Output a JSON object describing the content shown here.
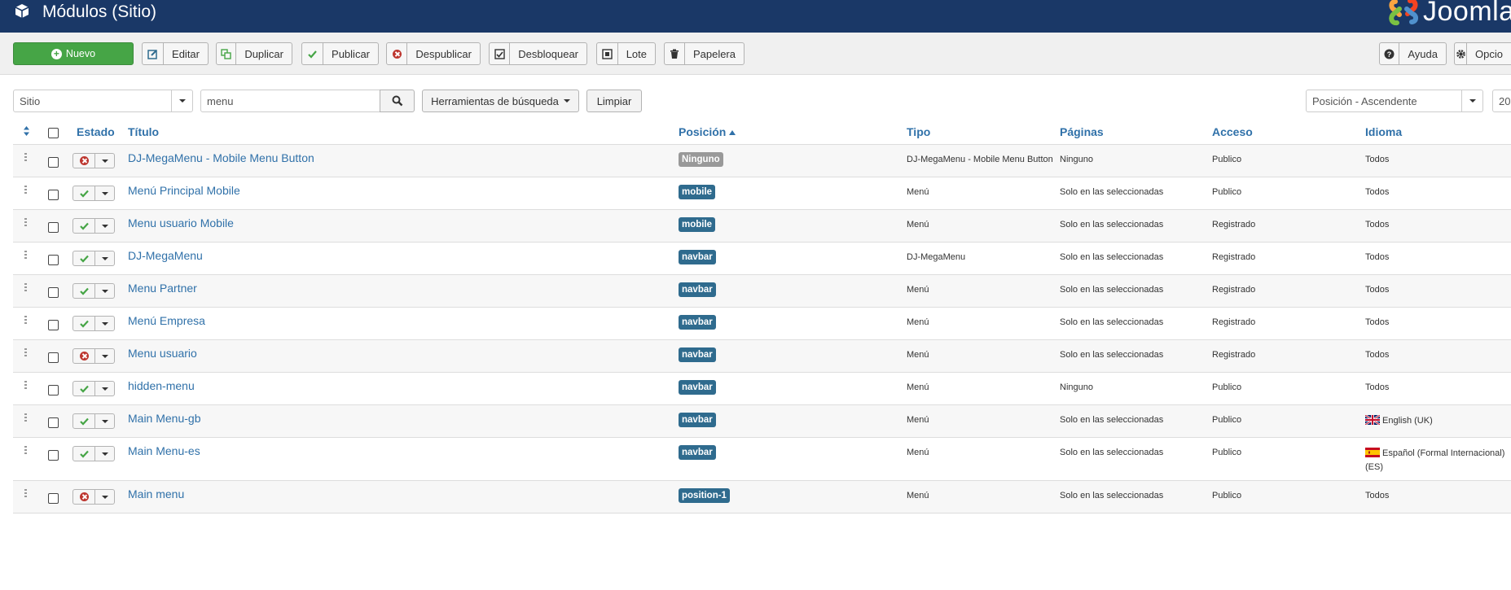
{
  "header": {
    "title": "Módulos (Sitio)",
    "logo_text": "Joomla"
  },
  "toolbar": {
    "new_label": "Nuevo",
    "edit_label": "Editar",
    "duplicate_label": "Duplicar",
    "publish_label": "Publicar",
    "unpublish_label": "Despublicar",
    "checkin_label": "Desbloquear",
    "batch_label": "Lote",
    "trash_label": "Papelera",
    "help_label": "Ayuda",
    "options_label": "Opcio"
  },
  "filters": {
    "client_value": "Sitio",
    "search_value": "menu",
    "search_tools_label": "Herramientas de búsqueda",
    "clear_label": "Limpiar",
    "ordering_value": "Posición - Ascendente",
    "limit_value": "20"
  },
  "columns": {
    "status": "Estado",
    "title": "Título",
    "position": "Posición",
    "type": "Tipo",
    "pages": "Páginas",
    "access": "Acceso",
    "language": "Idioma"
  },
  "rows": [
    {
      "title": "DJ-MegaMenu - Mobile Menu Button",
      "published": false,
      "position": "Ninguno",
      "position_color": "#999999",
      "type": "DJ-MegaMenu - Mobile Menu Button",
      "pages": "Ninguno",
      "access": "Publico",
      "language": "Todos"
    },
    {
      "title": "Menú Principal Mobile",
      "published": true,
      "position": "mobile",
      "position_color": "#2f6b8e",
      "type": "Menú",
      "pages": "Solo en las seleccionadas",
      "access": "Publico",
      "language": "Todos"
    },
    {
      "title": "Menu usuario Mobile",
      "published": true,
      "position": "mobile",
      "position_color": "#2f6b8e",
      "type": "Menú",
      "pages": "Solo en las seleccionadas",
      "access": "Registrado",
      "language": "Todos"
    },
    {
      "title": "DJ-MegaMenu",
      "published": true,
      "position": "navbar",
      "position_color": "#2f6b8e",
      "type": "DJ-MegaMenu",
      "pages": "Solo en las seleccionadas",
      "access": "Registrado",
      "language": "Todos"
    },
    {
      "title": "Menu Partner",
      "published": true,
      "position": "navbar",
      "position_color": "#2f6b8e",
      "type": "Menú",
      "pages": "Solo en las seleccionadas",
      "access": "Registrado",
      "language": "Todos"
    },
    {
      "title": "Menú Empresa",
      "published": true,
      "position": "navbar",
      "position_color": "#2f6b8e",
      "type": "Menú",
      "pages": "Solo en las seleccionadas",
      "access": "Registrado",
      "language": "Todos"
    },
    {
      "title": "Menu usuario",
      "published": false,
      "position": "navbar",
      "position_color": "#2f6b8e",
      "type": "Menú",
      "pages": "Solo en las seleccionadas",
      "access": "Registrado",
      "language": "Todos"
    },
    {
      "title": "hidden-menu",
      "published": true,
      "position": "navbar",
      "position_color": "#2f6b8e",
      "type": "Menú",
      "pages": "Ninguno",
      "access": "Publico",
      "language": "Todos"
    },
    {
      "title": "Main Menu-gb",
      "published": true,
      "position": "navbar",
      "position_color": "#2f6b8e",
      "type": "Menú",
      "pages": "Solo en las seleccionadas",
      "access": "Publico",
      "language": "English (UK)",
      "flag": "uk"
    },
    {
      "title": "Main Menu-es",
      "published": true,
      "position": "navbar",
      "position_color": "#2f6b8e",
      "type": "Menú",
      "pages": "Solo en las seleccionadas",
      "access": "Publico",
      "language": "Español (Formal Internacional)",
      "language_line2": "(ES)",
      "flag": "es"
    },
    {
      "title": "Main menu",
      "published": false,
      "position": "position-1",
      "position_color": "#2f6b8e",
      "type": "Menú",
      "pages": "Solo en las seleccionadas",
      "access": "Publico",
      "language": "Todos"
    }
  ],
  "colors": {
    "header_bg": "#1a3867",
    "link": "#3071a9",
    "success": "#46a546",
    "danger": "#bd362f",
    "badge": "#2f6b8e"
  }
}
